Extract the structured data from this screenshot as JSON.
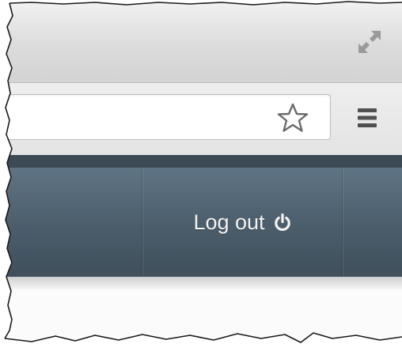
{
  "titlebar": {
    "fullscreen_icon": "expand-arrows-icon"
  },
  "toolbar": {
    "address_value": "",
    "star_icon": "star-outline-icon",
    "menu_icon": "hamburger-menu-icon"
  },
  "nav": {
    "logout_label": "Log out",
    "logout_icon": "power-icon"
  },
  "colors": {
    "nav_bar": "#4f6270",
    "nav_top_strip": "#3c4a55",
    "nav_text": "#f3f3f3",
    "chrome_bg": "#e6e6e6"
  }
}
